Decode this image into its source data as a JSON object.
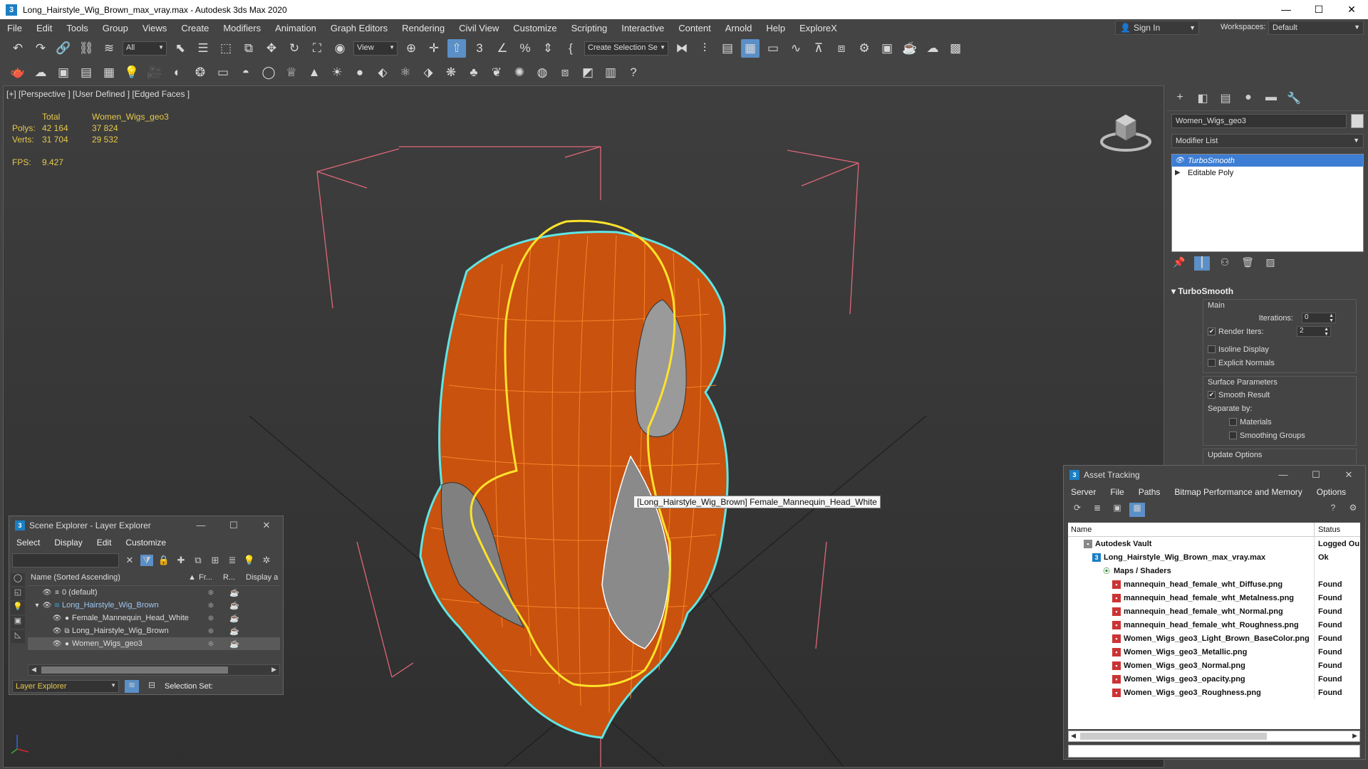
{
  "window": {
    "title": "Long_Hairstyle_Wig_Brown_max_vray.max - Autodesk 3ds Max 2020",
    "app_icon": "3"
  },
  "menu": [
    "File",
    "Edit",
    "Tools",
    "Group",
    "Views",
    "Create",
    "Modifiers",
    "Animation",
    "Graph Editors",
    "Rendering",
    "Civil View",
    "Customize",
    "Scripting",
    "Interactive",
    "Content",
    "Arnold",
    "Help",
    "ExploreX"
  ],
  "signin": {
    "label": "Sign In"
  },
  "workspaces": {
    "label": "Workspaces:",
    "value": "Default"
  },
  "toolbar": {
    "filter_select": "All",
    "view_select": "View",
    "selection_set": "Create Selection Se"
  },
  "viewport": {
    "label": "[+] [Perspective ] [User Defined ] [Edged Faces ]",
    "stats": {
      "header": [
        "",
        "Total",
        "Women_Wigs_geo3"
      ],
      "rows": [
        [
          "Polys:",
          "42 164",
          "37 824"
        ],
        [
          "Verts:",
          "31 704",
          "29 532"
        ]
      ],
      "fps_label": "FPS:",
      "fps_value": "9.427"
    },
    "tooltip": "[Long_Hairstyle_Wig_Brown] Female_Mannequin_Head_White"
  },
  "command_panel": {
    "object_name": "Women_Wigs_geo3",
    "modifier_list": "Modifier List",
    "stack": [
      {
        "label": "TurboSmooth",
        "selected": true
      },
      {
        "label": "Editable Poly",
        "selected": false
      }
    ],
    "rollout": {
      "title": "TurboSmooth",
      "main_group": "Main",
      "iterations_label": "Iterations:",
      "iterations_value": "0",
      "render_iters_label": "Render Iters:",
      "render_iters_value": "2",
      "isoline_label": "Isoline Display",
      "explicit_normals_label": "Explicit Normals",
      "surface_group": "Surface Parameters",
      "smooth_result_label": "Smooth Result",
      "separate_by_label": "Separate by:",
      "materials_label": "Materials",
      "smoothing_groups_label": "Smoothing Groups",
      "update_options_label": "Update Options"
    }
  },
  "scene_explorer": {
    "title": "Scene Explorer - Layer Explorer",
    "menu": [
      "Select",
      "Display",
      "Edit",
      "Customize"
    ],
    "columns": {
      "name": "Name (Sorted Ascending)",
      "frozen": "Fr...",
      "renderable": "R...",
      "display": "Display a"
    },
    "rows": [
      {
        "label": "0 (default)",
        "indent": 1,
        "selected": false,
        "highlight": false
      },
      {
        "label": "Long_Hairstyle_Wig_Brown",
        "indent": 1,
        "selected": false,
        "highlight": true
      },
      {
        "label": "Female_Mannequin_Head_White",
        "indent": 2,
        "selected": false,
        "highlight": false
      },
      {
        "label": "Long_Hairstyle_Wig_Brown",
        "indent": 2,
        "selected": false,
        "highlight": false
      },
      {
        "label": "Women_Wigs_geo3",
        "indent": 2,
        "selected": true,
        "highlight": false
      }
    ],
    "footer_select": "Layer Explorer",
    "selection_set_label": "Selection Set:"
  },
  "asset_tracking": {
    "title": "Asset Tracking",
    "menu": [
      "Server",
      "File",
      "Paths",
      "Bitmap Performance and Memory",
      "Options"
    ],
    "columns": {
      "name": "Name",
      "status": "Status"
    },
    "rows": [
      {
        "label": "Autodesk Vault",
        "status": "Logged Ou",
        "icon": "vault",
        "indent": 1
      },
      {
        "label": "Long_Hairstyle_Wig_Brown_max_vray.max",
        "status": "Ok",
        "icon": "max",
        "indent": 2
      },
      {
        "label": "Maps / Shaders",
        "status": "",
        "icon": "folder",
        "indent": 3
      },
      {
        "label": "mannequin_head_female_wht_Diffuse.png",
        "status": "Found",
        "icon": "png",
        "indent": 4
      },
      {
        "label": "mannequin_head_female_wht_Metalness.png",
        "status": "Found",
        "icon": "png",
        "indent": 4
      },
      {
        "label": "mannequin_head_female_wht_Normal.png",
        "status": "Found",
        "icon": "png",
        "indent": 4
      },
      {
        "label": "mannequin_head_female_wht_Roughness.png",
        "status": "Found",
        "icon": "png",
        "indent": 4
      },
      {
        "label": "Women_Wigs_geo3_Light_Brown_BaseColor.png",
        "status": "Found",
        "icon": "png",
        "indent": 4
      },
      {
        "label": "Women_Wigs_geo3_Metallic.png",
        "status": "Found",
        "icon": "png",
        "indent": 4
      },
      {
        "label": "Women_Wigs_geo3_Normal.png",
        "status": "Found",
        "icon": "png",
        "indent": 4
      },
      {
        "label": "Women_Wigs_geo3_opacity.png",
        "status": "Found",
        "icon": "png",
        "indent": 4
      },
      {
        "label": "Women_Wigs_geo3_Roughness.png",
        "status": "Found",
        "icon": "png",
        "indent": 4
      }
    ]
  },
  "colors": {
    "accent": "#5b8fc7",
    "selection_blue": "#3d7ed4",
    "stats_yellow": "#e6c84b",
    "wire_orange": "#ff7a1a",
    "selection_outline": "#5fe6e6",
    "bbox_pink": "#e0667a"
  }
}
